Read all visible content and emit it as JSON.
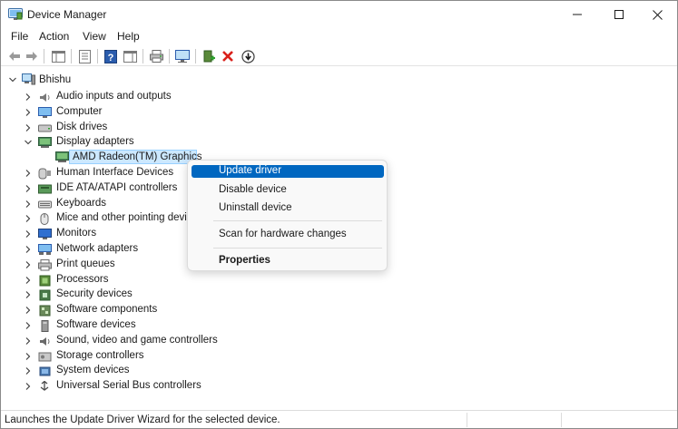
{
  "window": {
    "title": "Device Manager"
  },
  "menu": [
    "File",
    "Action",
    "View",
    "Help"
  ],
  "toolbar": {
    "icons": [
      "back-arrow-icon",
      "forward-arrow-icon",
      "show-hide-tree-icon",
      "properties-icon",
      "help-icon",
      "action-pane-icon",
      "print-icon",
      "monitor-icon",
      "add-driver-icon",
      "uninstall-icon",
      "update-driver-icon"
    ]
  },
  "tree": {
    "root": "Bhishu",
    "categories": [
      "Audio inputs and outputs",
      "Computer",
      "Disk drives",
      "Display adapters",
      "Human Interface Devices",
      "IDE ATA/ATAPI controllers",
      "Keyboards",
      "Mice and other pointing devices",
      "Monitors",
      "Network adapters",
      "Print queues",
      "Processors",
      "Security devices",
      "Software components",
      "Software devices",
      "Sound, video and game controllers",
      "Storage controllers",
      "System devices",
      "Universal Serial Bus controllers"
    ],
    "selected_device": "AMD Radeon(TM) Graphics"
  },
  "context_menu": {
    "items": [
      "Update driver",
      "Disable device",
      "Uninstall device",
      "Scan for hardware changes",
      "Properties"
    ]
  },
  "status": {
    "text": "Launches the Update Driver Wizard for the selected device."
  },
  "colors": {
    "accent": "#0067c0",
    "selection": "#cce8ff"
  }
}
